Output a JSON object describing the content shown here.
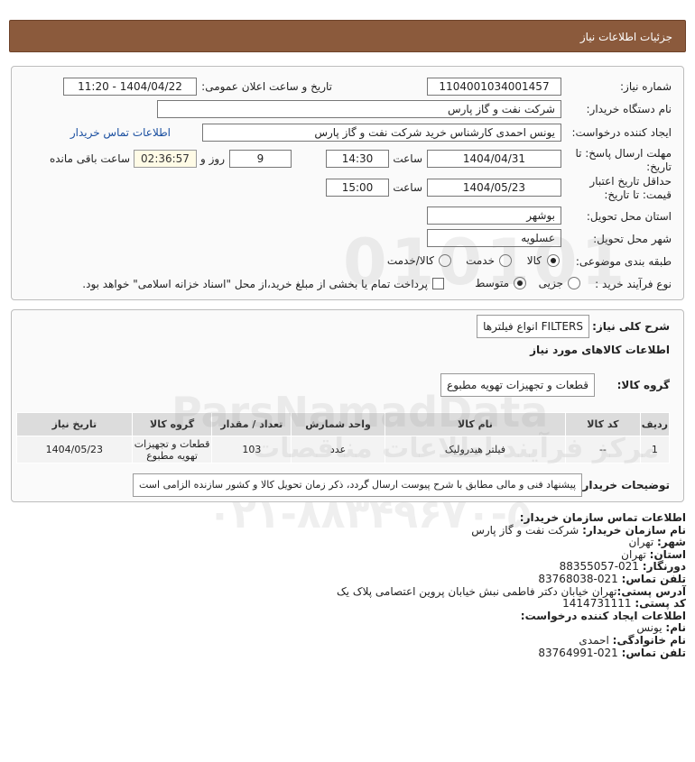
{
  "header": {
    "title": "جزئیات اطلاعات نیاز"
  },
  "form": {
    "need_number_label": "شماره نیاز:",
    "need_number": "1104001034001457",
    "announce_label": "تاریخ و ساعت اعلان عمومی:",
    "announce_value": "1404/04/22 - 11:20",
    "buyer_org_label": "نام دستگاه خریدار:",
    "buyer_org": "شرکت نفت و گاز پارس",
    "creator_label": "ایجاد کننده درخواست:",
    "creator": "یونس احمدی کارشناس خرید شرکت نفت و گاز پارس",
    "contact_link": "اطلاعات تماس خریدار",
    "deadline_label_1": "مهلت ارسال پاسخ: تا",
    "deadline_label_2": "تاریخ:",
    "deadline_date": "1404/04/31",
    "time_label": "ساعت",
    "deadline_time": "14:30",
    "days": "9",
    "days_label": "روز و",
    "remaining_time": "02:36:57",
    "remaining_label": "ساعت باقی مانده",
    "validity_label_1": "حداقل تاریخ اعتبار",
    "validity_label_2": "قیمت: تا تاریخ:",
    "validity_date": "1404/05/23",
    "validity_time": "15:00",
    "province_label": "استان محل تحویل:",
    "province": "بوشهر",
    "city_label": "شهر محل تحویل:",
    "city": "عسلویه",
    "category_label": "طبقه بندی موضوعی:",
    "category_options": [
      "کالا",
      "خدمت",
      "کالا/خدمت"
    ],
    "category_selected": "کالا",
    "process_label": "نوع فرآیند خرید :",
    "process_options": [
      "جزیی",
      "متوسط"
    ],
    "process_selected": "متوسط",
    "payment_note": "پرداخت تمام یا بخشی از مبلغ خرید،از محل \"اسناد خزانه اسلامی\" خواهد بود."
  },
  "details": {
    "summary_label": "شرح کلی نیاز:",
    "summary": "FILTERS انواع فیلترها",
    "goods_info_title": "اطلاعات کالاهای مورد نیاز",
    "goods_group_label": "گروه کالا:",
    "goods_group": "قطعات و تجهیزات تهویه مطبوع",
    "table": {
      "headers": [
        "ردیف",
        "کد کالا",
        "نام کالا",
        "واحد شمارش",
        "تعداد / مقدار",
        "گروه کالا",
        "تاریخ نیاز"
      ],
      "rows": [
        [
          "1",
          "--",
          "فیلتر هیدرولیک",
          "عدد",
          "103",
          "قطعات و تجهیزات تهویه مطبوع",
          "1404/05/23"
        ]
      ]
    },
    "buyer_notes_label": "توضیحات خریدار:",
    "buyer_notes": "پیشنهاد فنی و مالی مطابق با شرح پیوست ارسال گردد، ذکر زمان تحویل کالا و کشور سازنده الزامی است"
  },
  "contact": {
    "title": "اطلاعات تماس سازمان خریدار:",
    "buyer_name_label": "نام سازمان خریدار:",
    "buyer_name": "شرکت نفت و گاز پارس",
    "city_label": "شهر:",
    "city": "تهران",
    "province_label": "استان:",
    "province": "تهران",
    "fax_label": "دورنگار:",
    "fax": "021-88355057",
    "phone_label": "تلفن تماس:",
    "phone": "021-83768038",
    "address_label": "آدرس پستی:",
    "address": "تهران خیابان دکتر فاطمی نبش خیابان پروین اعتصامی پلاک یک",
    "postal_label": "کد پستی:",
    "postal": "1414731111",
    "creator_title": "اطلاعات ایجاد کننده درخواست:",
    "first_name_label": "نام:",
    "first_name": "یونس",
    "last_name_label": "نام خانوادگی:",
    "last_name": "احمدی",
    "creator_phone_label": "تلفن تماس:",
    "creator_phone": "021-83764991"
  },
  "watermark": {
    "brand": "ParsNamadData",
    "digits": "۰۲۱-۸۸۳۴۹۶۷۰-۵",
    "small": "مرکز فرآیند اطلاعات مناقصات",
    "number": "010101"
  }
}
